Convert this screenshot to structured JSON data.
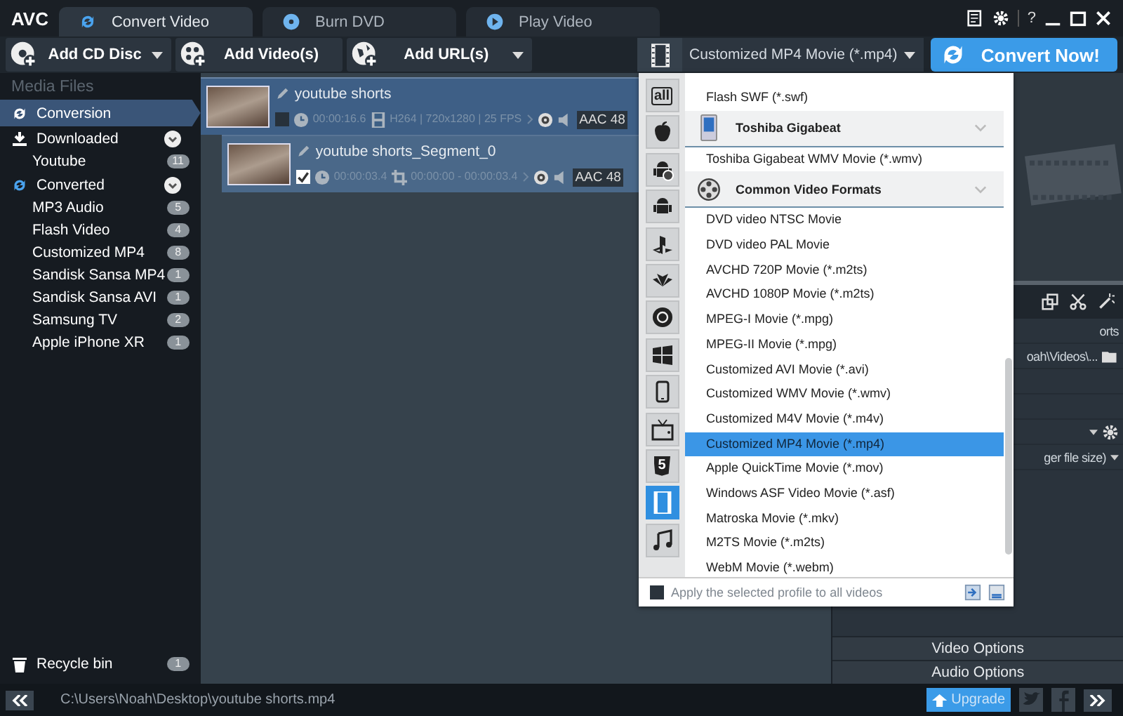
{
  "app_logo": "AVC",
  "tabs": [
    {
      "label": "Convert Video",
      "selected": true
    },
    {
      "label": "Burn DVD",
      "selected": false
    },
    {
      "label": "Play Video",
      "selected": false
    }
  ],
  "window_controls": {
    "help": "?"
  },
  "toolbar": [
    {
      "label": "Add CD Disc",
      "has_menu": true
    },
    {
      "label": "Add Video(s)",
      "has_menu": false
    },
    {
      "label": "Add URL(s)",
      "has_menu": true
    }
  ],
  "profile_select": {
    "value": "Customized MP4 Movie (*.mp4)"
  },
  "convert_button": "Convert Now!",
  "sidebar": {
    "heading": "Media Files",
    "items": [
      {
        "label": "Conversion",
        "selected": true,
        "expanded": false
      },
      {
        "label": "Downloaded",
        "selected": false,
        "expanded": true,
        "children": [
          {
            "label": "Youtube",
            "count": "11"
          }
        ]
      },
      {
        "label": "Converted",
        "selected": false,
        "expanded": true,
        "children": [
          {
            "label": "MP3 Audio",
            "count": "5"
          },
          {
            "label": "Flash Video",
            "count": "4"
          },
          {
            "label": "Customized MP4",
            "count": "8"
          },
          {
            "label": "Sandisk Sansa MP4",
            "count": "1"
          },
          {
            "label": "Sandisk Sansa AVI",
            "count": "1"
          },
          {
            "label": "Samsung TV",
            "count": "2"
          },
          {
            "label": "Apple iPhone XR",
            "count": "1"
          }
        ]
      }
    ],
    "recycle_bin": {
      "label": "Recycle bin",
      "count": "1"
    }
  },
  "files": [
    {
      "kind": "video",
      "title": "youtube shorts",
      "checked": false,
      "duration": "00:00:16.6",
      "info": "H264 | 720x1280 | 25 FPS",
      "audio": "AAC 48"
    },
    {
      "kind": "segment",
      "title": "youtube shorts_Segment_0",
      "checked": true,
      "duration": "00:00:03.4",
      "info": "00:00:00 - 00:00:03.4",
      "audio": "AAC 48"
    }
  ],
  "profile_menu": {
    "categories": [
      {
        "kind": "all",
        "label": "all",
        "selected": false
      },
      {
        "kind": "apple",
        "selected": false
      },
      {
        "kind": "android-s",
        "selected": false
      },
      {
        "kind": "android",
        "selected": false
      },
      {
        "kind": "playstation",
        "selected": false
      },
      {
        "kind": "huawei",
        "selected": false
      },
      {
        "kind": "globe",
        "selected": false
      },
      {
        "kind": "windows",
        "selected": false
      },
      {
        "kind": "phone",
        "selected": false
      },
      {
        "kind": "tv",
        "selected": false
      },
      {
        "kind": "html5",
        "label": "5",
        "selected": false
      },
      {
        "kind": "film",
        "selected": true
      },
      {
        "kind": "music",
        "selected": false
      }
    ],
    "items": [
      {
        "kind": "item",
        "label": "Flash SWF (*.swf)",
        "selected": false
      },
      {
        "kind": "group",
        "label": "Toshiba Gigabeat"
      },
      {
        "kind": "item",
        "label": "Toshiba Gigabeat WMV Movie (*.wmv)",
        "selected": false
      },
      {
        "kind": "group",
        "label": "Common Video Formats"
      },
      {
        "kind": "item",
        "label": "DVD video NTSC Movie",
        "selected": false
      },
      {
        "kind": "item",
        "label": "DVD video PAL Movie",
        "selected": false
      },
      {
        "kind": "item",
        "label": "AVCHD 720P Movie (*.m2ts)",
        "selected": false
      },
      {
        "kind": "item",
        "label": "AVCHD 1080P Movie (*.m2ts)",
        "selected": false
      },
      {
        "kind": "item",
        "label": "MPEG-I Movie (*.mpg)",
        "selected": false
      },
      {
        "kind": "item",
        "label": "MPEG-II Movie (*.mpg)",
        "selected": false
      },
      {
        "kind": "item",
        "label": "Customized AVI Movie (*.avi)",
        "selected": false
      },
      {
        "kind": "item",
        "label": "Customized WMV Movie (*.wmv)",
        "selected": false
      },
      {
        "kind": "item",
        "label": "Customized M4V Movie (*.m4v)",
        "selected": false
      },
      {
        "kind": "item",
        "label": "Customized MP4 Movie (*.mp4)",
        "selected": true
      },
      {
        "kind": "item",
        "label": "Apple QuickTime Movie (*.mov)",
        "selected": false
      },
      {
        "kind": "item",
        "label": "Windows ASF Video Movie (*.asf)",
        "selected": false
      },
      {
        "kind": "item",
        "label": "Matroska Movie (*.mkv)",
        "selected": false
      },
      {
        "kind": "item",
        "label": "M2TS Movie (*.m2ts)",
        "selected": false
      },
      {
        "kind": "item",
        "label": "WebM Movie (*.webm)",
        "selected": false
      }
    ],
    "apply_all": {
      "label": "Apply the selected profile to all videos",
      "checked": false
    }
  },
  "right_panel": {
    "name_fragment": "orts",
    "folder_fragment": "oah\\Videos\\...",
    "quality_fragment": "ger file size)",
    "buttons": [
      "Video Options",
      "Audio Options"
    ]
  },
  "status_bar": {
    "path": "C:\\Users\\Noah\\Desktop\\youtube shorts.mp4",
    "upgrade": "Upgrade"
  }
}
